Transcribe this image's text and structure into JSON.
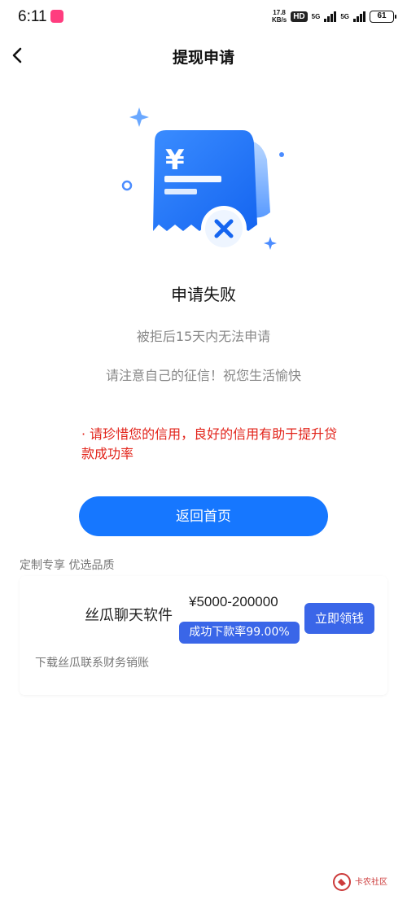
{
  "status_bar": {
    "time": "6:11",
    "speed_value": "17.8",
    "speed_unit": "KB/s",
    "hd": "HD",
    "net1": "5G",
    "net2": "5G",
    "battery": "61"
  },
  "nav": {
    "title": "提现申请",
    "back_icon": "chevron-left-icon"
  },
  "result": {
    "title": "申请失败",
    "subtitle_1": "被拒后15天内无法申请",
    "subtitle_2": "请注意自己的征信！祝您生活愉快"
  },
  "warning": "· 请珍惜您的信用，良好的信用有助于提升贷款成功率",
  "home_button": "返回首页",
  "section_label": "定制专享 优选品质",
  "ad": {
    "name": "丝瓜聊天软件",
    "amount": "¥5000-200000",
    "rate": "成功下款率99.00%",
    "button": "立即领钱",
    "description": "下载丝瓜联系财务销账"
  },
  "watermark": {
    "text": "卡农社区"
  },
  "colors": {
    "primary": "#1677ff",
    "warning": "#e2231a",
    "ad_blue": "#3a66e8"
  }
}
